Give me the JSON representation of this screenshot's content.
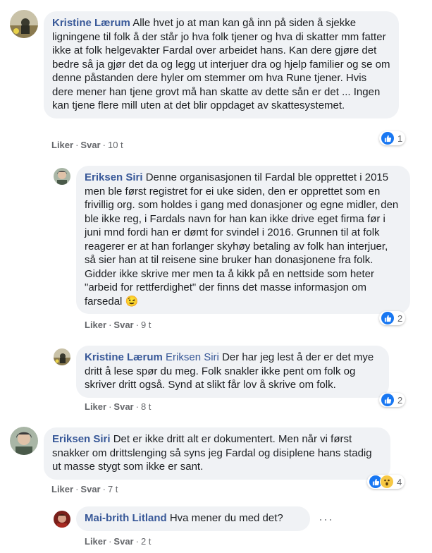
{
  "colors": {
    "link": "#385898",
    "bubble": "#f0f2f5",
    "like": "#1877f2",
    "meta": "#65676b"
  },
  "comments": [
    {
      "author": "Kristine Lærum",
      "text": "Alle hvet jo at man kan gå inn på siden å sjekke ligningene til folk å der står jo hva folk tjener og hva di skatter mm fatter ikke at folk helgevakter Fardal over arbeidet hans. Kan dere gjøre det bedre så ja gjør det da og legg ut interjuer dra og hjelp familier og se om denne påstanden dere hyler om stemmer om hva Rune tjener. Hvis dere mener han tjene grovt må han skatte av dette sån er det ... Ingen kan tjene flere mill uten at det blir oppdaget av skattesystemet.",
      "like_label": "Liker",
      "reply_label": "Svar",
      "time": "10 t",
      "reactions": {
        "icons": [
          "like-icon"
        ],
        "count": "1"
      }
    },
    {
      "author": "Eriksen Siri",
      "text": "Denne organisasjonen til Fardal ble opprettet i 2015 men ble først registret for ei uke siden, den er opprettet som en frivillig org. som holdes i gang med donasjoner og egne midler, den ble ikke reg, i Fardals navn for han kan ikke drive eget firma før i juni mnd fordi han er dømt for svindel i 2016. Grunnen til at folk reagerer er at han forlanger skyhøy betaling av folk han interjuer, så sier han at til reisene sine bruker han donasjonene fra folk. Gidder ikke skrive mer men ta å kikk på en nettside som heter \"arbeid for rettferdighet\" der finns det masse informasjon om farsedal",
      "emoji": "😉",
      "like_label": "Liker",
      "reply_label": "Svar",
      "time": "9 t",
      "reactions": {
        "icons": [
          "like-icon"
        ],
        "count": "2"
      }
    },
    {
      "author": "Kristine Lærum",
      "mention": "Eriksen Siri",
      "text": "Der har jeg lest å der er det mye dritt å lese spør du meg. Folk snakler ikke pent om folk og skriver dritt også. Synd at slikt får lov å skrive om folk.",
      "like_label": "Liker",
      "reply_label": "Svar",
      "time": "8 t",
      "reactions": {
        "icons": [
          "like-icon"
        ],
        "count": "2"
      }
    },
    {
      "author": "Eriksen Siri",
      "text": "Det er ikke dritt alt er dokumentert. Men når vi først snakker om drittslenging så syns jeg Fardal og disiplene hans stadig ut masse stygt som ikke er sant.",
      "like_label": "Liker",
      "reply_label": "Svar",
      "time": "7 t",
      "reactions": {
        "icons": [
          "like-icon",
          "wow-icon"
        ],
        "count": "4"
      }
    },
    {
      "author": "Mai-brith Litland",
      "text": "Hva mener du med det?",
      "like_label": "Liker",
      "reply_label": "Svar",
      "time": "2 t",
      "more_label": "···"
    }
  ]
}
